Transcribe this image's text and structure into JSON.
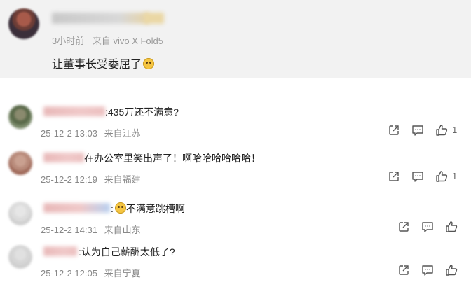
{
  "top_post": {
    "time": "3小时前",
    "source": "来自 vivo X Fold5",
    "text": "让董事长受委屈了"
  },
  "comments": [
    {
      "text": ":435万还不满意?",
      "date": "25-12-2 13:03",
      "location": "来自江苏",
      "likes": "1"
    },
    {
      "text": "在办公室里笑出声了！啊哈哈哈哈哈哈！",
      "date": "25-12-2 12:19",
      "location": "来自福建",
      "likes": "1"
    },
    {
      "text": "不满意跳槽啊",
      "prefix": ":",
      "date": "25-12-2 14:31",
      "location": "来自山东",
      "likes": ""
    },
    {
      "text": ":认为自己薪酬太低了?",
      "date": "25-12-2 12:05",
      "location": "来自宁夏",
      "likes": ""
    }
  ],
  "icons": {
    "share": "share-icon",
    "comment": "comment-icon",
    "like": "like-icon",
    "emoji": "emoji-icon"
  }
}
